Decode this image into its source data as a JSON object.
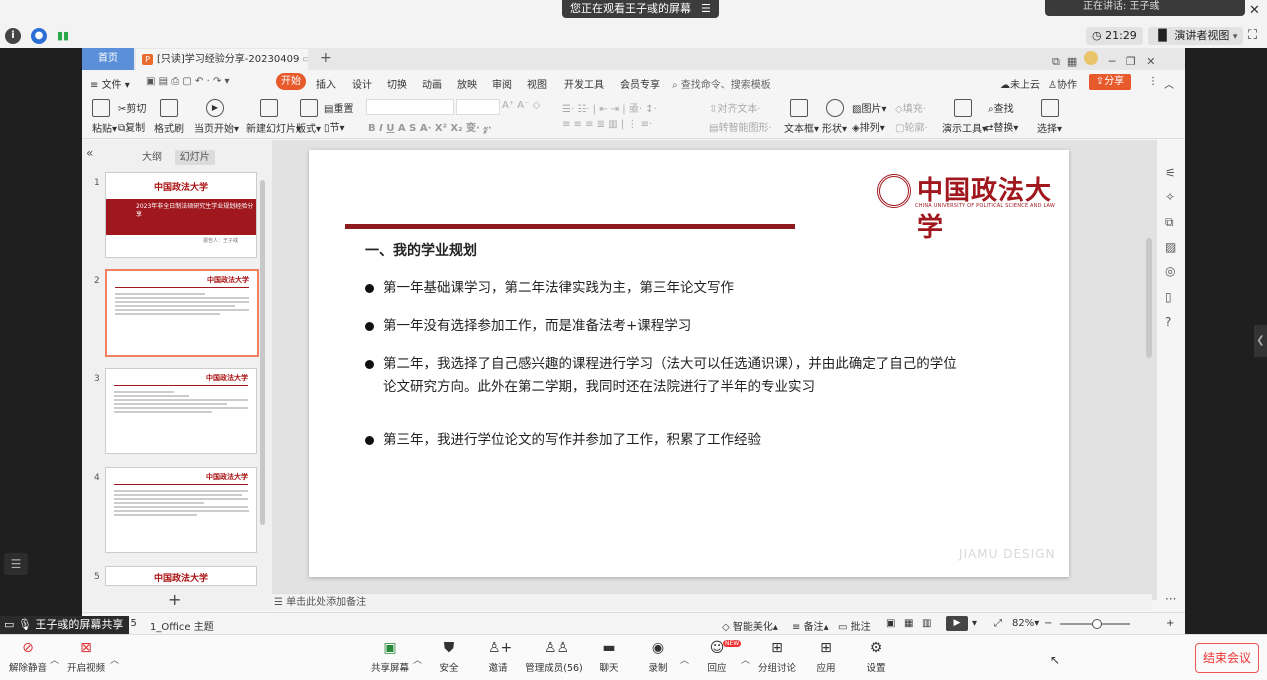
{
  "meeting": {
    "share_banner": "您正在观看王子彧的屏幕",
    "speaking": "正在讲话: 王子彧",
    "clock": "21:29",
    "view_mode": "演讲者视图",
    "share_label": "王子彧的屏幕共享",
    "bottom": {
      "mute": "解除静音",
      "video": "开启视频",
      "share": "共享屏幕",
      "security": "安全",
      "invite": "邀请",
      "members": "管理成员(56)",
      "chat": "聊天",
      "record": "录制",
      "react": "回应",
      "react_badge": "NEW",
      "breakout": "分组讨论",
      "apps": "应用",
      "settings": "设置",
      "end": "结束会议"
    }
  },
  "wps": {
    "home_tab": "首页",
    "doc_tab": "[只读]学习经验分享-20230409",
    "menu": {
      "file": "文件",
      "start": "开始",
      "insert": "插入",
      "design": "设计",
      "transition": "切换",
      "animation": "动画",
      "show": "放映",
      "review": "审阅",
      "view": "视图",
      "devtools": "开发工具",
      "member": "会员专享",
      "search": "查找命令、搜索模板",
      "cloud": "未上云",
      "collab": "协作",
      "share": "分享"
    },
    "ribbon": {
      "paste": "粘贴",
      "cut": "剪切",
      "copy": "复制",
      "format_painter": "格式刷",
      "from_current": "当页开始",
      "new_slide": "新建幻灯片",
      "layout": "版式",
      "section": "节",
      "reset": "重置",
      "align_text": "对齐文本",
      "smartart": "转智能图形",
      "textbox": "文本框",
      "shape": "形状",
      "picture": "图片",
      "arrange": "排列",
      "fill": "填充",
      "outline": "轮廓",
      "presenter_tools": "演示工具",
      "find": "查找",
      "replace": "替换",
      "select": "选择"
    },
    "panel": {
      "outline_tab": "大纲",
      "slides_tab": "幻灯片",
      "slide_numbers": [
        "1",
        "2",
        "3",
        "4",
        "5"
      ],
      "thumb1_title": "2023年非全日制法硕研究生学业规划经验分享",
      "thumb1_author": "报告人：王子彧"
    },
    "slide": {
      "logo_cn": "中国政法大学",
      "logo_en": "CHINA UNIVERSITY OF POLITICAL SCIENCE AND LAW",
      "heading": "一、我的学业规划",
      "bullets": [
        "第一年基础课学习，第二年法律实践为主，第三年论文写作",
        "第一年没有选择参加工作，而是准备法考+课程学习",
        "第二年，我选择了自己感兴趣的课程进行学习（法大可以任选通识课），并由此确定了自己的学位论文研究方向。此外在第二学期，我同时还在法院进行了半年的专业实习",
        "第三年，我进行学位论文的写作并参加了工作，积累了工作经验"
      ],
      "watermark": "JIAMU DESIGN"
    },
    "notes_placeholder": "单击此处添加备注",
    "status": {
      "page": "/ 5",
      "theme": "1_Office 主题",
      "beautify": "智能美化",
      "notes": "备注",
      "comments": "批注",
      "zoom": "82%"
    }
  },
  "colors": {
    "accent": "#e8592c",
    "brand_red": "#a0181e",
    "end_red": "#e33333"
  }
}
